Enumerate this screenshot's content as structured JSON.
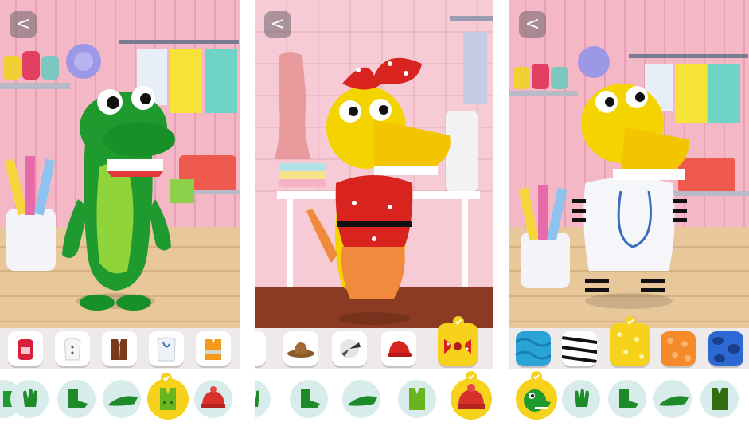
{
  "screens": [
    {
      "id": "screen-1",
      "back_icon": "<",
      "character": "green-dino",
      "item_tiles": [
        "backpack",
        "white-shirt",
        "brown-vest",
        "lab-coat",
        "orange-vest"
      ],
      "category_circles": [
        "arms",
        "feet",
        "tail",
        "vest",
        "hat"
      ],
      "selected_category": "vest"
    },
    {
      "id": "screen-2",
      "back_icon": "<",
      "character": "yellow-dino-red-dress",
      "item_tiles": [
        "cowboy-hat",
        "cap",
        "red-helmet",
        "polka-bow"
      ],
      "selected_item": "polka-bow",
      "category_circles": [
        "arms",
        "feet",
        "tail",
        "vest",
        "hat"
      ],
      "selected_category": "hat"
    },
    {
      "id": "screen-3",
      "back_icon": "<",
      "character": "yellow-dino-doctor",
      "item_tiles": [
        "blue-pattern",
        "zebra-pattern",
        "yellow-star-pattern",
        "orange-heart-pattern",
        "blue-spot-pattern"
      ],
      "selected_item": "yellow-star-pattern",
      "category_circles": [
        "skin",
        "arms",
        "feet",
        "tail",
        "vest"
      ],
      "selected_category": "skin"
    }
  ],
  "colors": {
    "accent_yellow": "#f7d21c",
    "wall_pink": "#f3b7c6",
    "floor_wood": "#e8c79a",
    "dino_green": "#1f9a2e",
    "dino_yellow": "#f4d400",
    "category_bg": "#d9ecec"
  }
}
